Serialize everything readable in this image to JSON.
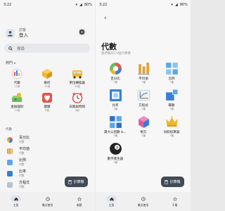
{
  "left": {
    "status_time": "3:22",
    "status_battery": "80%",
    "profile": {
      "guest_label": "訪客",
      "login_label": "登入"
    },
    "search_placeholder": "搜尋",
    "section_hot": "熱門",
    "hot_categories": [
      {
        "name": "代數",
        "count": "11個",
        "icon": "chart-icon"
      },
      {
        "name": "幾何",
        "count": "12個",
        "icon": "gem-icon"
      },
      {
        "name": "單位轉換器",
        "count": "47個",
        "icon": "bus-icon"
      },
      {
        "name": "金融理財",
        "count": "12個",
        "icon": "money-icon"
      },
      {
        "name": "健康",
        "count": "9個",
        "icon": "heart-icon"
      },
      {
        "name": "日期與時間",
        "count": "4個",
        "icon": "clock-icon"
      }
    ],
    "section_algebra": "代數",
    "algebra_items": [
      {
        "name": "百分比",
        "sub": "代數"
      },
      {
        "name": "平均值",
        "sub": "代數"
      },
      {
        "name": "比例",
        "sub": "代數"
      },
      {
        "name": "比率",
        "sub": "代數"
      },
      {
        "name": "方程式",
        "sub": "代數"
      }
    ],
    "fab_label": "計算機",
    "nav": [
      {
        "label": "主頁",
        "icon": "home-icon"
      },
      {
        "label": "最近使用",
        "icon": "clock-icon"
      },
      {
        "label": "收藏",
        "icon": "star-icon"
      }
    ]
  },
  "right": {
    "status_time": "3:22",
    "status_battery": "80%",
    "title": "代數",
    "subtitle": "我們擁有11個計算機",
    "items": [
      {
        "name": "百分比",
        "count": "7種",
        "icon": "pie-icon"
      },
      {
        "name": "平均值",
        "count": "7種",
        "icon": "bars-icon"
      },
      {
        "name": "比例",
        "count": "7種",
        "icon": "squares-icon"
      },
      {
        "name": "比率",
        "count": "7種",
        "icon": "frame-icon"
      },
      {
        "name": "方程式",
        "count": "7種",
        "icon": "axis-icon"
      },
      {
        "name": "冪數",
        "count": "7種",
        "icon": "power-icon"
      },
      {
        "name": "最大公因數 &...",
        "count": "7種",
        "icon": "blocks-icon"
      },
      {
        "name": "根方",
        "count": "7種",
        "icon": "cube-icon"
      },
      {
        "name": "同餘核算器",
        "count": "7種",
        "icon": "crown-icon"
      },
      {
        "name": "數字產生器",
        "count": "7種",
        "icon": "eight-ball-icon"
      }
    ],
    "fab_label": "計算機",
    "nav": [
      {
        "label": "主頁",
        "icon": "home-icon"
      },
      {
        "label": "最近使用",
        "icon": "clock-icon"
      },
      {
        "label": "千萬",
        "icon": "star-icon"
      }
    ]
  }
}
